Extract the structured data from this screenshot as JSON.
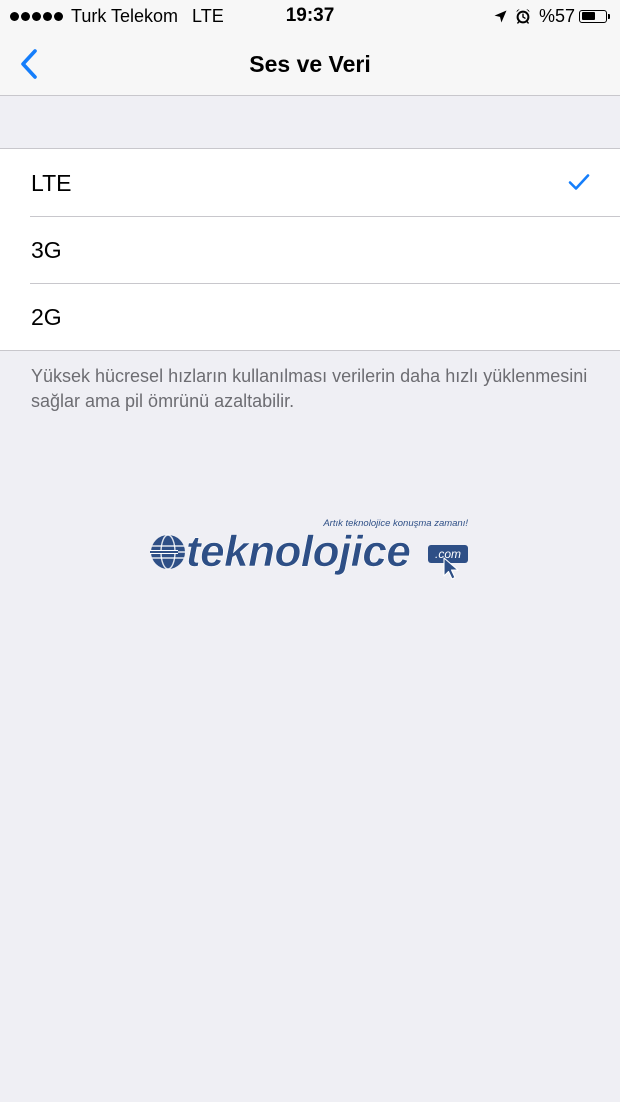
{
  "status_bar": {
    "carrier": "Turk Telekom",
    "network": "LTE",
    "time": "19:37",
    "battery_text": "%57",
    "battery_level": 0.57,
    "signal_icon": "signal-dots-icon",
    "location_icon": "location-arrow-icon",
    "alarm_icon": "alarm-clock-icon"
  },
  "nav": {
    "title": "Ses ve Veri",
    "back_icon": "chevron-left-icon"
  },
  "options": [
    {
      "label": "LTE",
      "selected": true
    },
    {
      "label": "3G",
      "selected": false
    },
    {
      "label": "2G",
      "selected": false
    }
  ],
  "footer": {
    "text": "Yüksek hücresel hızların kullanılması verilerin daha hızlı yüklenmesini sağlar ama pil ömrünü azaltabilir."
  },
  "watermark": {
    "logo_text": "teknolojice",
    "domain_suffix": ".com",
    "tagline": "Artık teknolojice konuşma zamanı!"
  },
  "colors": {
    "accent": "#157efb",
    "background": "#efeff4",
    "separator": "#c8c7cc",
    "footer_text": "#6d6d72",
    "logo_blue": "#2e4f86"
  }
}
